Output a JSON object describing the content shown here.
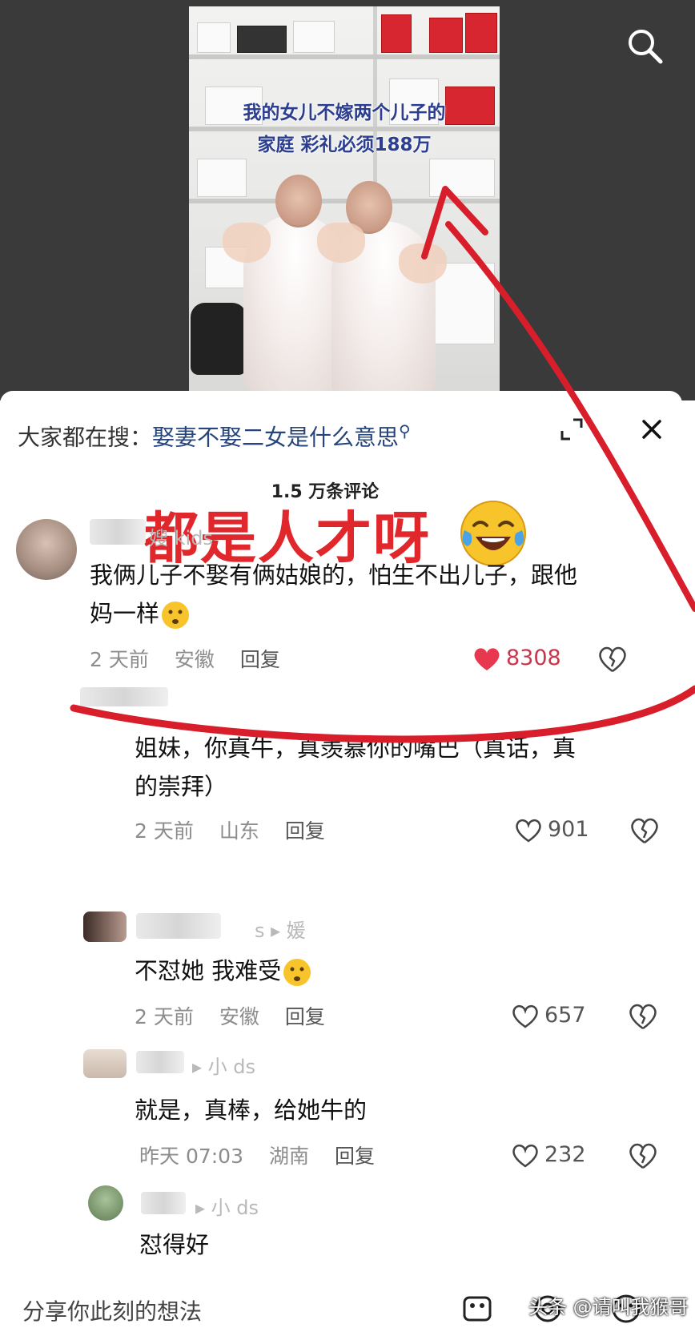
{
  "video": {
    "caption_line1": "我的女儿不嫁两个儿子的",
    "caption_line2": "家庭 彩礼必须188万"
  },
  "sheet": {
    "search_prefix": "大家都在搜：",
    "search_query": "娶妻不娶二女是什么意思",
    "comment_count": "1.5 万条评论"
  },
  "overlay": {
    "text": "都是人才呀",
    "emoji": "tears-of-joy-emoji"
  },
  "comments": [
    {
      "name_tail": "嫂 kids",
      "text_line1": "我俩儿子不娶有俩姑娘的，怕生不出儿子，跟他",
      "text_line2": "妈一样",
      "time": "2 天前",
      "location": "安徽",
      "reply": "回复",
      "likes": "8308",
      "liked": true
    },
    {
      "text_line1": "姐妹，你真牛，真羡慕你的嘴巴（真话，真",
      "text_line2": "的崇拜）",
      "time": "2 天前",
      "location": "山东",
      "reply": "回复",
      "likes": "901"
    },
    {
      "name_tail": "s ▸ 媛",
      "text_line1": "不怼她 我难受",
      "time": "2 天前",
      "location": "安徽",
      "reply": "回复",
      "likes": "657"
    },
    {
      "name_tail": "▸ 小    ds",
      "text_line1": "就是，真棒，给她牛的",
      "time": "昨天 07:03",
      "location": "湖南",
      "reply": "回复",
      "likes": "232"
    },
    {
      "name_tail": "▸ 小    ds",
      "text_line1": "怼得好"
    }
  ],
  "input": {
    "placeholder": "分享你此刻的想法"
  },
  "watermark": "头条 @请叫我猴哥",
  "colors": {
    "accent_red": "#e0272b",
    "link_blue": "#26457c",
    "like_red": "#e8384f"
  }
}
